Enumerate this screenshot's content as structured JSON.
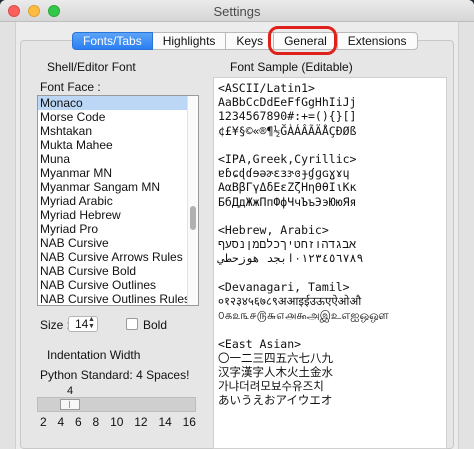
{
  "window": {
    "title": "Settings"
  },
  "tabs": [
    {
      "label": "Fonts/Tabs",
      "selected": true
    },
    {
      "label": "Highlights",
      "selected": false
    },
    {
      "label": "Keys",
      "selected": false
    },
    {
      "label": "General",
      "selected": false
    },
    {
      "label": "Extensions",
      "selected": false
    }
  ],
  "shell_font": {
    "section_title": "Shell/Editor Font",
    "font_face_label": "Font Face :",
    "fonts": [
      "Monaco",
      "Morse Code",
      "Mshtakan",
      "Mukta Mahee",
      "Muna",
      "Myanmar MN",
      "Myanmar Sangam MN",
      "Myriad Arabic",
      "Myriad Hebrew",
      "Myriad Pro",
      "NAB Cursive",
      "NAB Cursive Arrows Rules",
      "NAB Cursive Bold",
      "NAB Cursive Outlines",
      "NAB Cursive Outlines Rules"
    ],
    "selected_font": "Monaco",
    "size_label": "Size :",
    "size_value": "14",
    "bold_label": "Bold"
  },
  "indentation": {
    "section_title": "Indentation Width",
    "standard_label": "Python Standard: 4 Spaces!",
    "value": "4",
    "ticks": [
      "2",
      "4",
      "6",
      "8",
      "10",
      "12",
      "14",
      "16"
    ]
  },
  "sample": {
    "section_title": "Font Sample (Editable)",
    "text": "<ASCII/Latin1>\nAaBbCcDdEeFfGgHhIiJj\n1234567890#:+=(){}[]\n¢£¥§©«®¶½ĞÀÁÂÃÄÅÇÐØß\n\n<IPA,Greek,Cyrillic>\nɐɓɕɖɗɘəɚɛɜɝɞɟɠɡɢɣɤɥ\nΑαΒβΓγΔδΕεΖζΗηΘθΙιΚκ\nБбДдЖжПпФфЧчЪъЭэЮюЯя\n\n<Hebrew, Arabic>\nאבגדהוזחטיךכלםמןנסעף\n٠١٢٣٤٥٦٧٨٩ابجد هوزحطي\n\n<Devanagari, Tamil>\n०१२३४५६७८९अआइईउऊएऐओऔ\n௦௧௨௩௪௫௬௭௮௯அஇஉஎஐஒஔ\n\n<East Asian>\n〇一二三四五六七八九\n汉字漢字人木火土金水\n가냐더려모뵤수유즈치\nあいうえおアイウエオ"
  }
}
